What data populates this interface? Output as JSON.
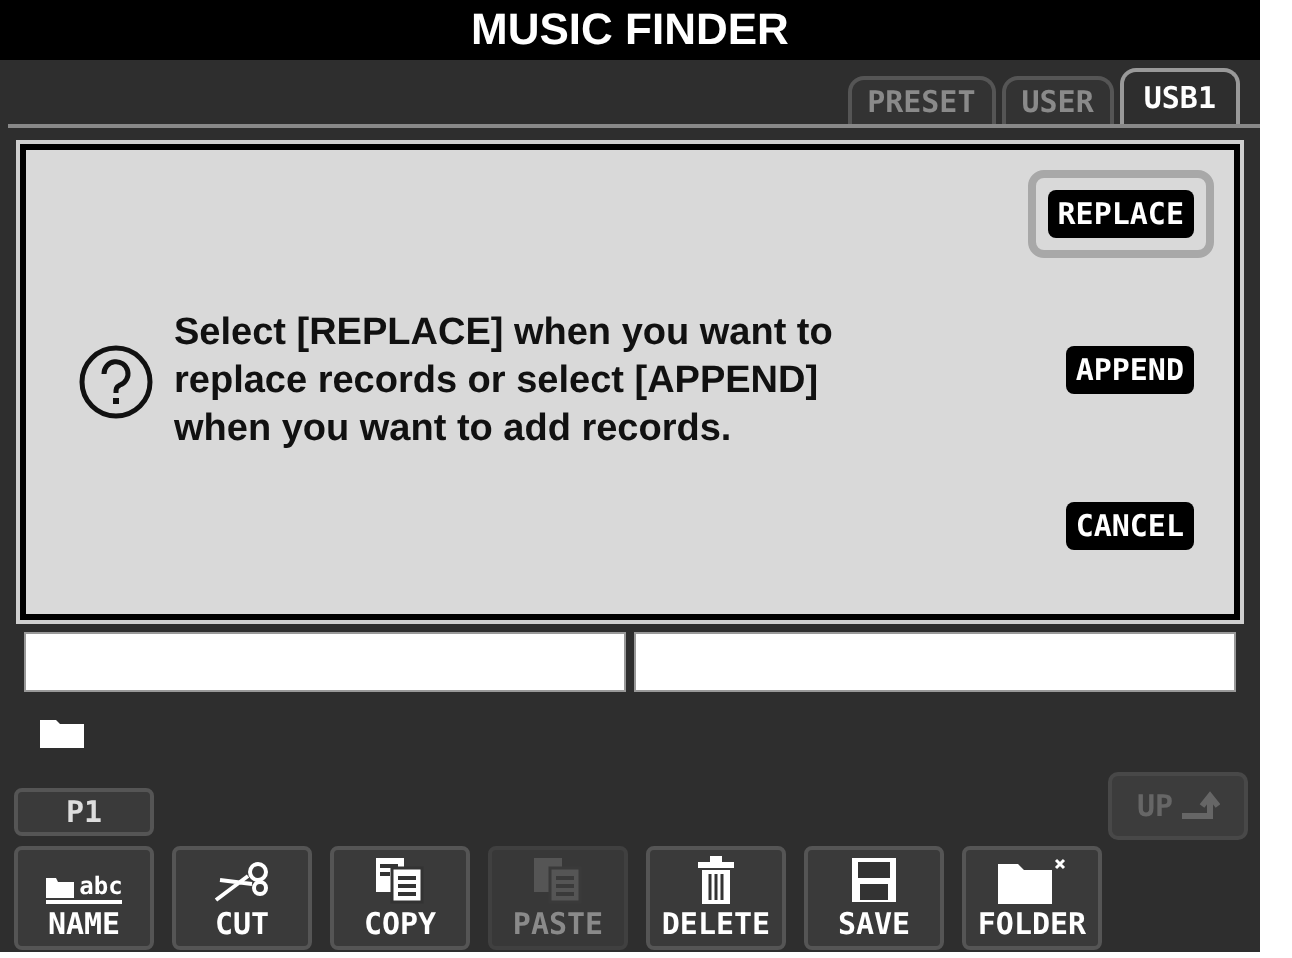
{
  "window": {
    "title": "MUSIC FINDER"
  },
  "tabs": [
    {
      "label": "PRESET",
      "selected": false
    },
    {
      "label": "USER",
      "selected": false
    },
    {
      "label": "USB1",
      "selected": true
    }
  ],
  "dialog": {
    "message": "Select [REPLACE] when you want to replace records or select [APPEND] when you want to add records.",
    "buttons": [
      {
        "label": "REPLACE",
        "selected": true
      },
      {
        "label": "APPEND",
        "selected": false
      },
      {
        "label": "CANCEL",
        "selected": false
      }
    ]
  },
  "page_button": {
    "label": "P1"
  },
  "up_button": {
    "label": "UP",
    "disabled": true
  },
  "toolbar": [
    {
      "label": "NAME",
      "kind": "name",
      "icon_text": "abc",
      "disabled": false
    },
    {
      "label": "CUT",
      "kind": "cut",
      "disabled": false
    },
    {
      "label": "COPY",
      "kind": "copy",
      "disabled": false
    },
    {
      "label": "PASTE",
      "kind": "paste",
      "disabled": true
    },
    {
      "label": "DELETE",
      "kind": "delete",
      "disabled": false
    },
    {
      "label": "SAVE",
      "kind": "save",
      "disabled": false
    },
    {
      "label": "FOLDER",
      "kind": "folder",
      "disabled": false
    }
  ]
}
